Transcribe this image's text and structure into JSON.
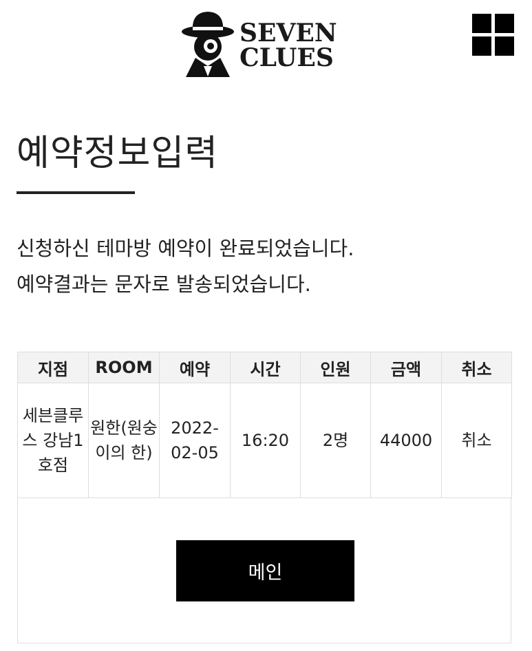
{
  "header": {
    "logo_line1": "SEVEN",
    "logo_line2": "CLUES",
    "logo_icon": "detective-icon",
    "menu_icon": "grid-menu-icon"
  },
  "page": {
    "title": "예약정보입력",
    "message_line1": "신청하신 테마방 예약이 완료되었습니다.",
    "message_line2": "예약결과는 문자로 발송되었습니다."
  },
  "table": {
    "headers": [
      "지점",
      "ROOM",
      "예약",
      "시간",
      "인원",
      "금액",
      "취소"
    ],
    "row": {
      "branch": "세븐클루스 강남1호점",
      "room": "원한(원숭이의 한)",
      "date": "2022-02-05",
      "time": "16:20",
      "people": "2명",
      "price": "44000",
      "cancel": "취소"
    }
  },
  "buttons": {
    "main": "메인"
  },
  "colors": {
    "accent": "#000000",
    "border": "#dddddd",
    "header_bg": "#f3f3f3"
  }
}
